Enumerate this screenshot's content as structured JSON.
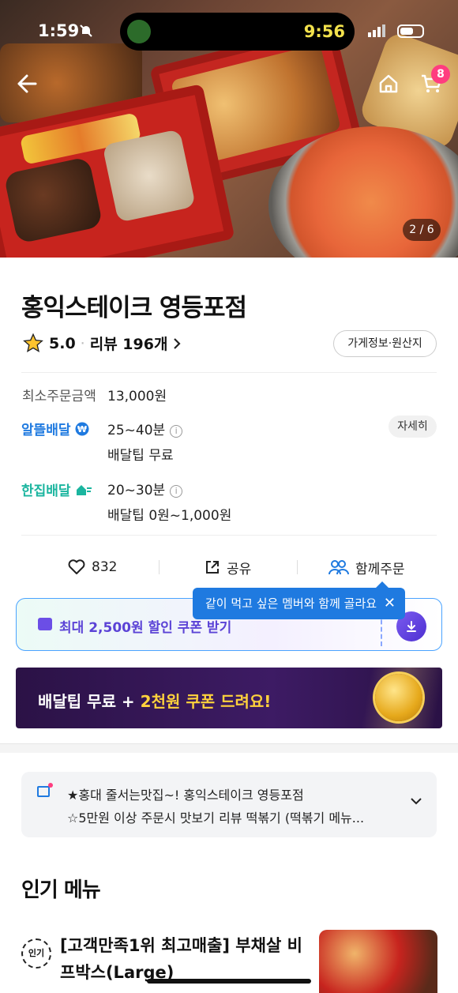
{
  "status_bar": {
    "time": "1:59",
    "center_time": "9:56"
  },
  "header": {
    "cart_count": "8",
    "image_pager": "2 / 6"
  },
  "store": {
    "name": "홍익스테이크 영등포점",
    "rating": "5.0",
    "review_label": "리뷰 196개",
    "info_button": "가게정보·원산지"
  },
  "order": {
    "min_order_label": "최소주문금액",
    "min_order_value": "13,000원",
    "saver_badge": "알뜰배달",
    "saver_time": "25~40분",
    "saver_tip": "배달팁 무료",
    "detail_button": "자세히",
    "single_badge": "한집배달",
    "single_time": "20~30분",
    "single_tip": "배달팁 0원~1,000원"
  },
  "actions": {
    "like_count": "832",
    "share_label": "공유",
    "group_order_label": "함께주문"
  },
  "tooltip": {
    "text": "같이 먹고 싶은 멤버와 함께 골라요"
  },
  "coupon": {
    "label": "최대 2,500원 할인 쿠폰 받기"
  },
  "banner": {
    "text_a": "배달팁 무료 + ",
    "text_b": "2천원 쿠폰 드려요!"
  },
  "notice": {
    "line1": "★홍대 줄서는맛집~! 홍익스테이크 영등포점",
    "line2": "☆5만원 이상 주문시 맛보기 리뷰 떡볶기 (떡볶기 메뉴..."
  },
  "popular": {
    "title": "인기 메뉴",
    "badge": "인기",
    "item_name": "[고객만족1위 최고매출] 부채살 비프박스(Large)"
  },
  "colors": {
    "accent_blue": "#1f7ae0",
    "teal": "#1bb59f",
    "cart_badge": "#ff3d7f",
    "coupon_purple": "#5b43d6"
  }
}
